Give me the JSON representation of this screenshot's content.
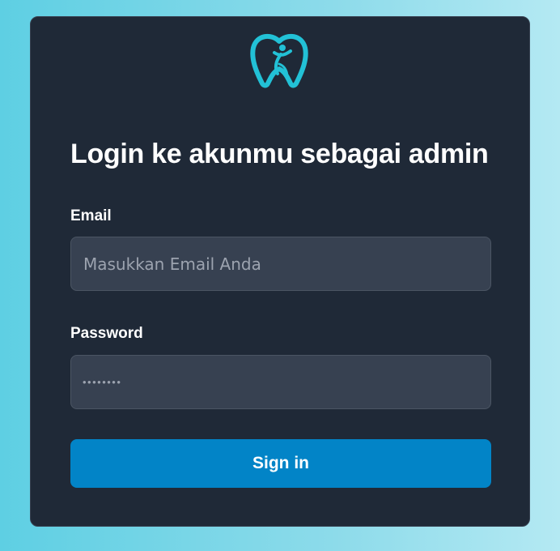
{
  "logo": {
    "icon": "tooth-person-icon",
    "color": "#22c1d6"
  },
  "form": {
    "title": "Login ke akunmu sebagai admin",
    "email": {
      "label": "Email",
      "value": "",
      "placeholder": "Masukkan Email Anda"
    },
    "password": {
      "label": "Password",
      "masked_value": "••••••••"
    },
    "submit_label": "Sign in"
  },
  "colors": {
    "card_bg": "#1f2937",
    "input_bg": "#374151",
    "accent": "#0284c7"
  }
}
